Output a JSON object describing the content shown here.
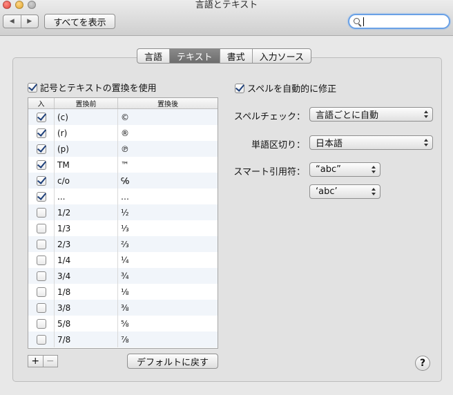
{
  "window": {
    "title": "言語とテキスト"
  },
  "toolbar": {
    "back": "◀",
    "forward": "▶",
    "show_all_label": "すべてを表示",
    "search_value": ""
  },
  "tabs": [
    {
      "label": "言語",
      "selected": false
    },
    {
      "label": "テキスト",
      "selected": true
    },
    {
      "label": "書式",
      "selected": false
    },
    {
      "label": "入力ソース",
      "selected": false
    }
  ],
  "replacement": {
    "checkbox_label": "記号とテキストの置換を使用",
    "checked": true,
    "columns": {
      "on": "入",
      "before": "置換前",
      "after": "置換後"
    },
    "rows": [
      {
        "on": true,
        "before": "(c)",
        "after": "©"
      },
      {
        "on": true,
        "before": "(r)",
        "after": "®"
      },
      {
        "on": true,
        "before": "(p)",
        "after": "℗"
      },
      {
        "on": true,
        "before": "TM",
        "after": "™"
      },
      {
        "on": true,
        "before": "c/o",
        "after": "℅"
      },
      {
        "on": true,
        "before": "...",
        "after": "…"
      },
      {
        "on": false,
        "before": "1/2",
        "after": "½"
      },
      {
        "on": false,
        "before": "1/3",
        "after": "⅓"
      },
      {
        "on": false,
        "before": "2/3",
        "after": "⅔"
      },
      {
        "on": false,
        "before": "1/4",
        "after": "¼"
      },
      {
        "on": false,
        "before": "3/4",
        "after": "¾"
      },
      {
        "on": false,
        "before": "1/8",
        "after": "⅛"
      },
      {
        "on": false,
        "before": "3/8",
        "after": "⅜"
      },
      {
        "on": false,
        "before": "5/8",
        "after": "⅝"
      },
      {
        "on": false,
        "before": "7/8",
        "after": "⅞"
      }
    ],
    "add_label": "+",
    "remove_label": "−",
    "default_button_label": "デフォルトに戻す"
  },
  "spelling": {
    "autocorrect_label": "スペルを自動的に修正",
    "autocorrect_checked": true,
    "spellcheck_label": "スペルチェック：",
    "spellcheck_value": "言語ごとに自動",
    "word_break_label": "単語区切り：",
    "word_break_value": "日本語",
    "smart_quotes_label": "スマート引用符：",
    "double_quote_value": "“abc”",
    "single_quote_value": "‘abc’"
  },
  "help_label": "?"
}
